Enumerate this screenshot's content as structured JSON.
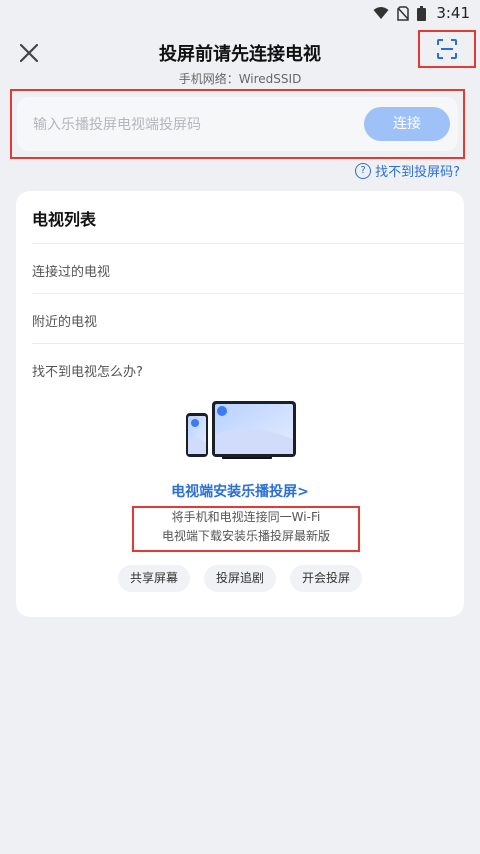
{
  "status_bar": {
    "time": "3:41"
  },
  "header": {
    "title": "投屏前请先连接电视",
    "subtitle": "手机网络：WiredSSID"
  },
  "connect_form": {
    "placeholder": "输入乐播投屏电视端投屏码",
    "button": "连接"
  },
  "help_link": "找不到投屏码?",
  "tv_list": {
    "title": "电视列表",
    "rows": [
      "连接过的电视",
      "附近的电视",
      "找不到电视怎么办?"
    ],
    "install_link": "电视端安装乐播投屏>",
    "steps": [
      "将手机和电视连接同一Wi-Fi",
      "电视端下载安装乐播投屏最新版"
    ],
    "chips": [
      "共享屏幕",
      "投屏追剧",
      "开会投屏"
    ]
  },
  "colors": {
    "accent": "#2a6fd8",
    "button": "#9ec2f7",
    "highlight": "#e53935",
    "background": "#eef0f3"
  }
}
